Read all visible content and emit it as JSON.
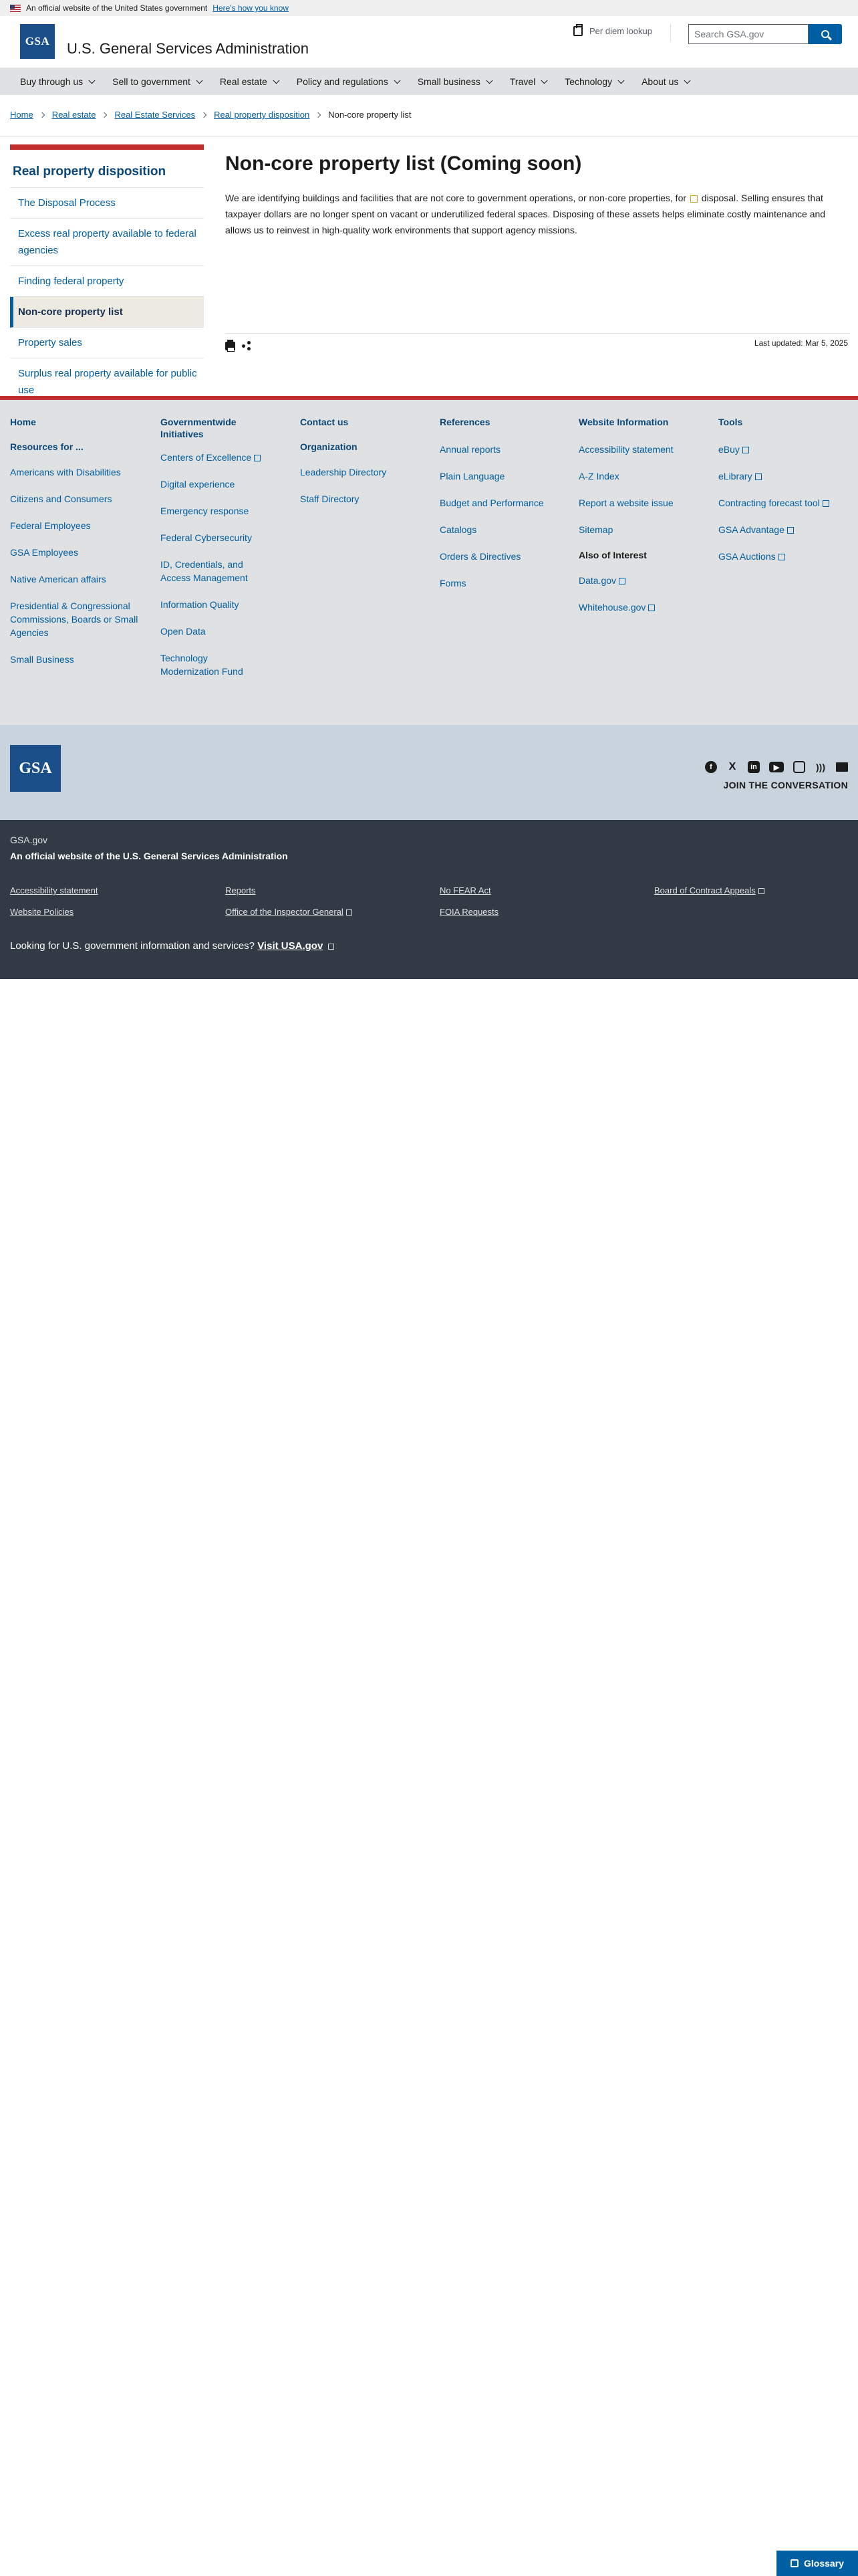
{
  "gov_banner": {
    "text": "An official website of the United States government",
    "link": "Here's how you know"
  },
  "header": {
    "logo": "GSA",
    "title": "U.S. General Services Administration",
    "per_diem": "Per diem lookup",
    "search_placeholder": "Search GSA.gov"
  },
  "nav": {
    "items": [
      "Buy through us",
      "Sell to government",
      "Real estate",
      "Policy and regulations",
      "Small business",
      "Travel",
      "Technology",
      "About us"
    ]
  },
  "breadcrumb": {
    "items": [
      "Home",
      "Real estate",
      "Real Estate Services",
      "Real property disposition"
    ],
    "current": "Non-core property list"
  },
  "sidebar": {
    "heading": "Real property disposition",
    "items": [
      "The Disposal Process",
      "Excess real property available to federal agencies",
      "Finding federal property",
      "Non-core property list",
      "Property sales",
      "Surplus real property available for public use"
    ]
  },
  "main": {
    "title": "Non-core property list (Coming soon)",
    "intro_part1": "We are identifying buildings and facilities that are not core to government operations, or non-core properties, for",
    "intro_part2": "disposal. Selling ensures that taxpayer dollars are no longer spent on vacant or underutilized federal spaces. Disposing of these assets helps eliminate costly maintenance and allows us to reinvest in high-quality work environments that support agency missions.",
    "last_updated": "Last updated: Mar 5, 2025"
  },
  "footer": {
    "col1": {
      "head": "Home",
      "sub": "Resources for ...",
      "links": [
        "Americans with Disabilities",
        "Citizens and Consumers",
        "Federal Employees",
        "GSA Employees",
        "Native American affairs",
        "Presidential & Congressional Commissions, Boards or Small Agencies",
        "Small Business"
      ]
    },
    "col2": {
      "head": "Governmentwide Initiatives",
      "links": [
        "Centers of Excellence",
        "Digital experience",
        "Emergency response",
        "Federal Cybersecurity",
        "ID, Credentials, and Access Management",
        "Information Quality",
        "Open Data",
        "Technology Modernization Fund"
      ]
    },
    "col3": {
      "head": "Contact us",
      "sub": "Organization",
      "links": [
        "Leadership Directory",
        "Staff Directory"
      ]
    },
    "col4": {
      "head": "References",
      "links": [
        "Annual reports",
        "Plain Language",
        "Budget and Performance",
        "Catalogs",
        "Orders & Directives",
        "Forms"
      ]
    },
    "col5": {
      "head": "Website Information",
      "links": [
        "Accessibility statement",
        "A-Z Index",
        "Report a website issue",
        "Sitemap"
      ],
      "sub": "Also of Interest",
      "links2": [
        "Data.gov",
        "Whitehouse.gov"
      ]
    },
    "col6": {
      "head": "Tools",
      "links": [
        "eBuy",
        "eLibrary",
        "Contracting forecast tool",
        "GSA Advantage",
        "GSA Auctions"
      ]
    },
    "logo": "GSA",
    "join": "JOIN THE CONVERSATION",
    "social_icons": [
      "facebook-icon",
      "x-icon",
      "linkedin-icon",
      "youtube-icon",
      "instagram-icon",
      "rss-icon",
      "email-icon"
    ]
  },
  "identifier": {
    "domain": "GSA.gov",
    "agency": "An official website of the U.S. General Services Administration",
    "links": [
      "Accessibility statement",
      "Reports",
      "No FEAR Act",
      "Board of Contract Appeals",
      "Website Policies",
      "Office of the Inspector General",
      "FOIA Requests"
    ],
    "usa_text": "Looking for U.S. government information and services?",
    "usa_link": "Visit USA.gov"
  },
  "glossary": "Glossary",
  "colors": {
    "primary": "#005ea2",
    "dark_blue": "#0b4778",
    "accent_red": "#b50909",
    "footer_dark": "#323a45"
  }
}
